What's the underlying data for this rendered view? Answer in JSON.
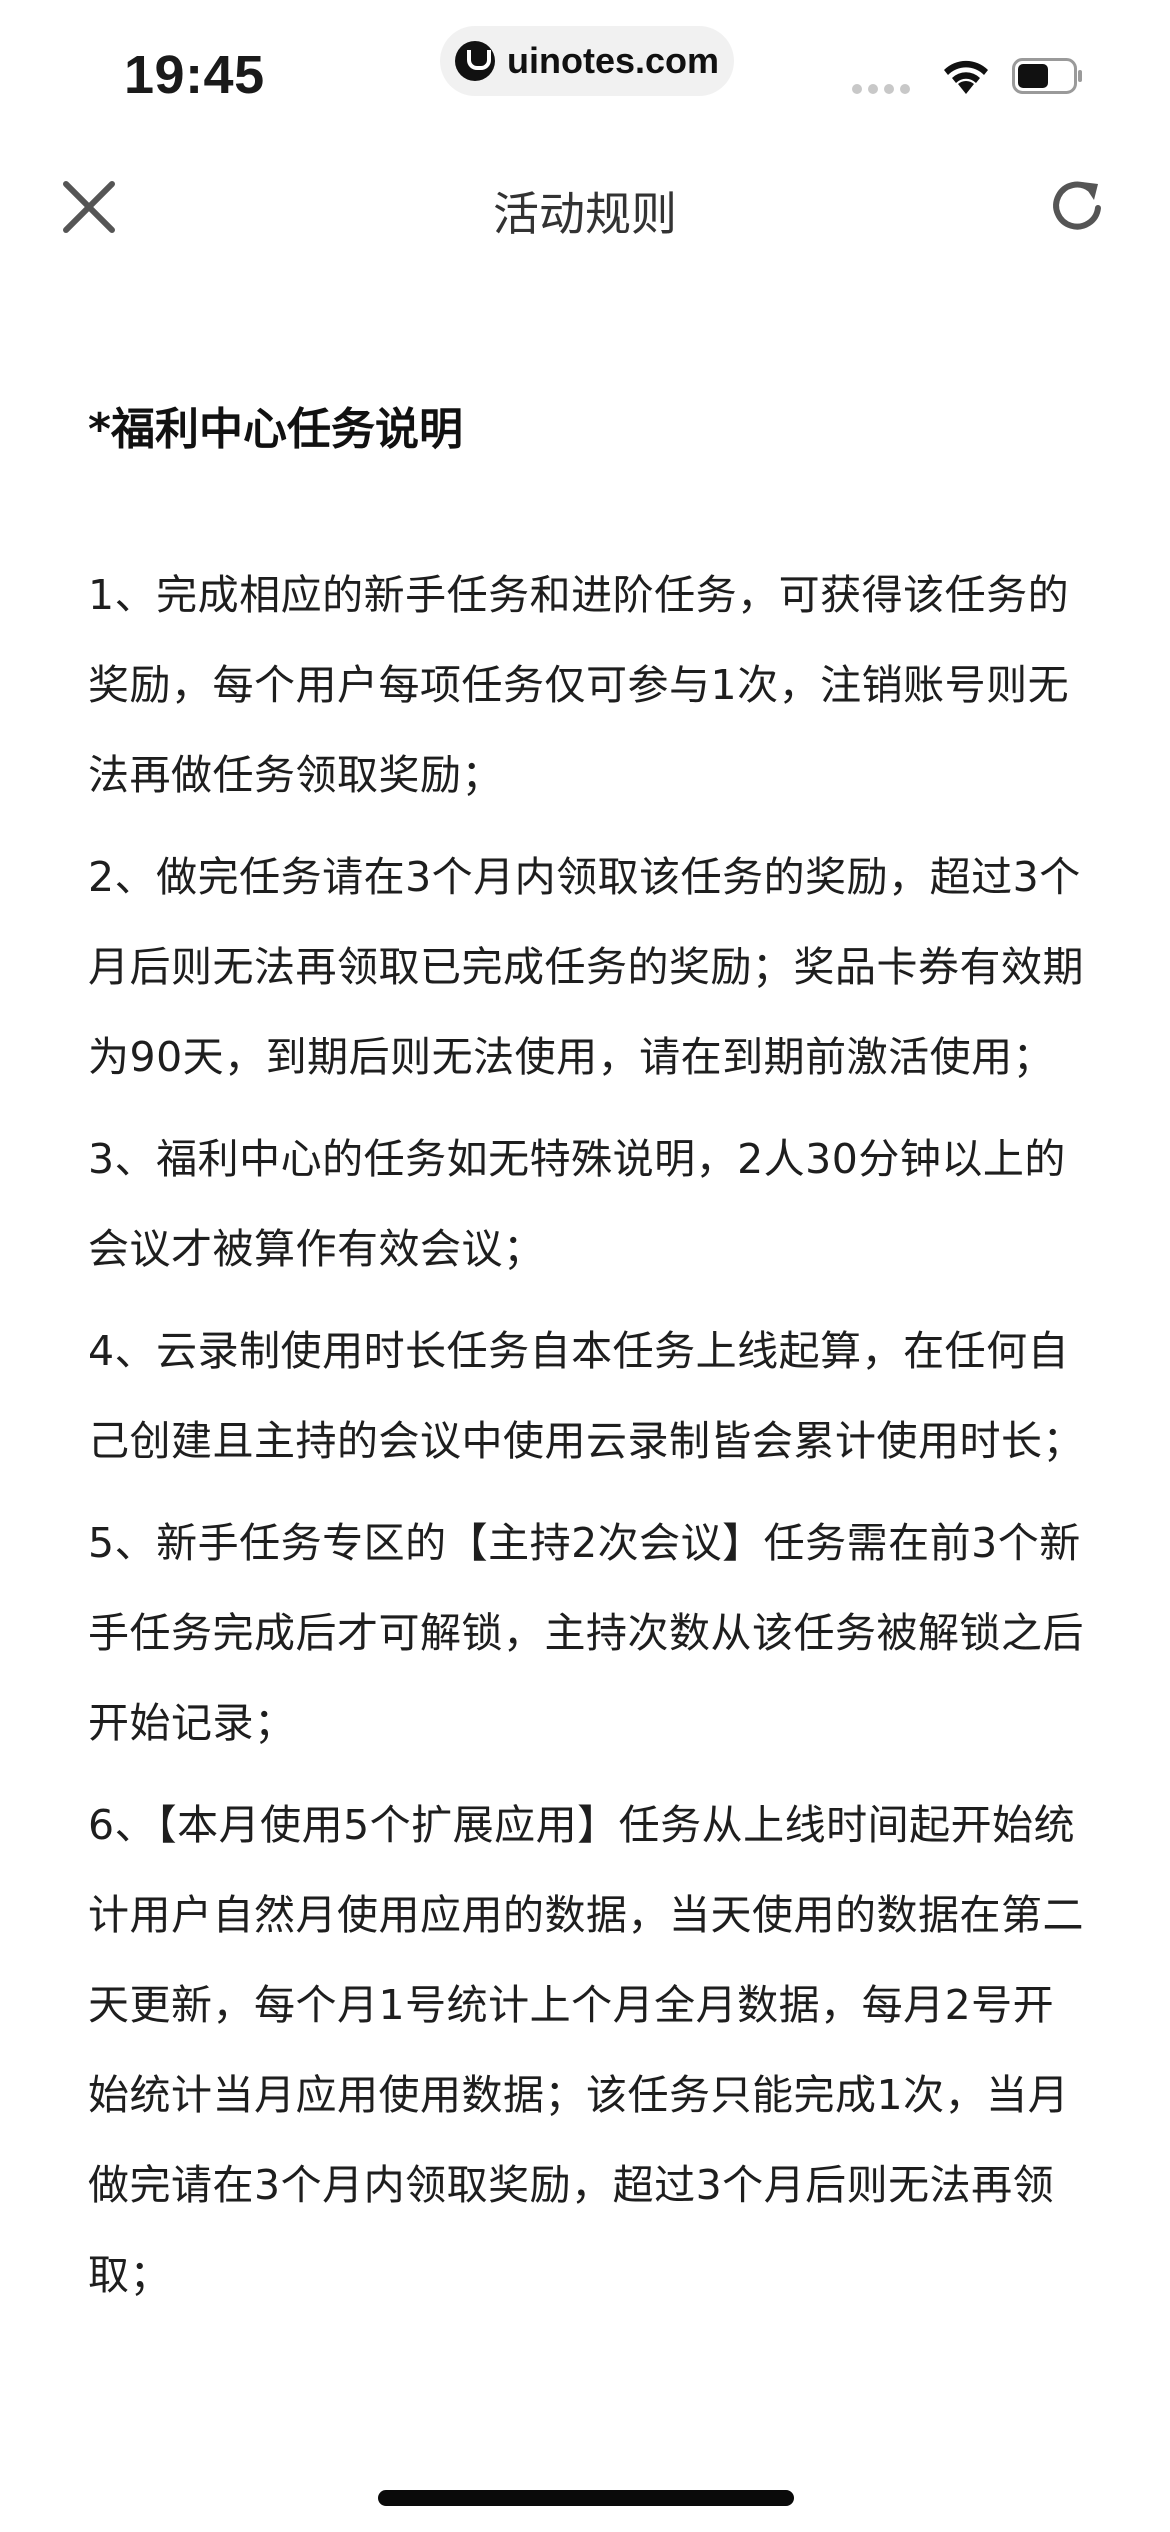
{
  "status_bar": {
    "time": "19:45",
    "url": "uinotes.com"
  },
  "nav": {
    "title": "活动规则",
    "close_icon": "close-icon",
    "refresh_icon": "refresh-icon"
  },
  "content": {
    "section_title": "*福利中心任务说明",
    "rules": [
      "1、完成相应的新手任务和进阶任务，可获得该任务的奖励，每个用户每项任务仅可参与1次，注销账号则无法再做任务领取奖励；",
      "2、做完任务请在3个月内领取该任务的奖励，超过3个月后则无法再领取已完成任务的奖励；奖品卡券有效期为90天，到期后则无法使用，请在到期前激活使用；",
      "3、福利中心的任务如无特殊说明，2人30分钟以上的会议才被算作有效会议；",
      "4、云录制使用时长任务自本任务上线起算，在任何自己创建且主持的会议中使用云录制皆会累计使用时长；",
      "5、新手任务专区的【主持2次会议】任务需在前3个新手任务完成后才可解锁，主持次数从该任务被解锁之后开始记录；",
      "6、【本月使用5个扩展应用】任务从上线时间起开始统计用户自然月使用应用的数据，当天使用的数据在第二天更新，每个月1号统计上个月全月数据，每月2号开始统计当月应用使用数据；该任务只能完成1次，当月做完请在3个月内领取奖励，超过3个月后则无法再领取；"
    ]
  }
}
